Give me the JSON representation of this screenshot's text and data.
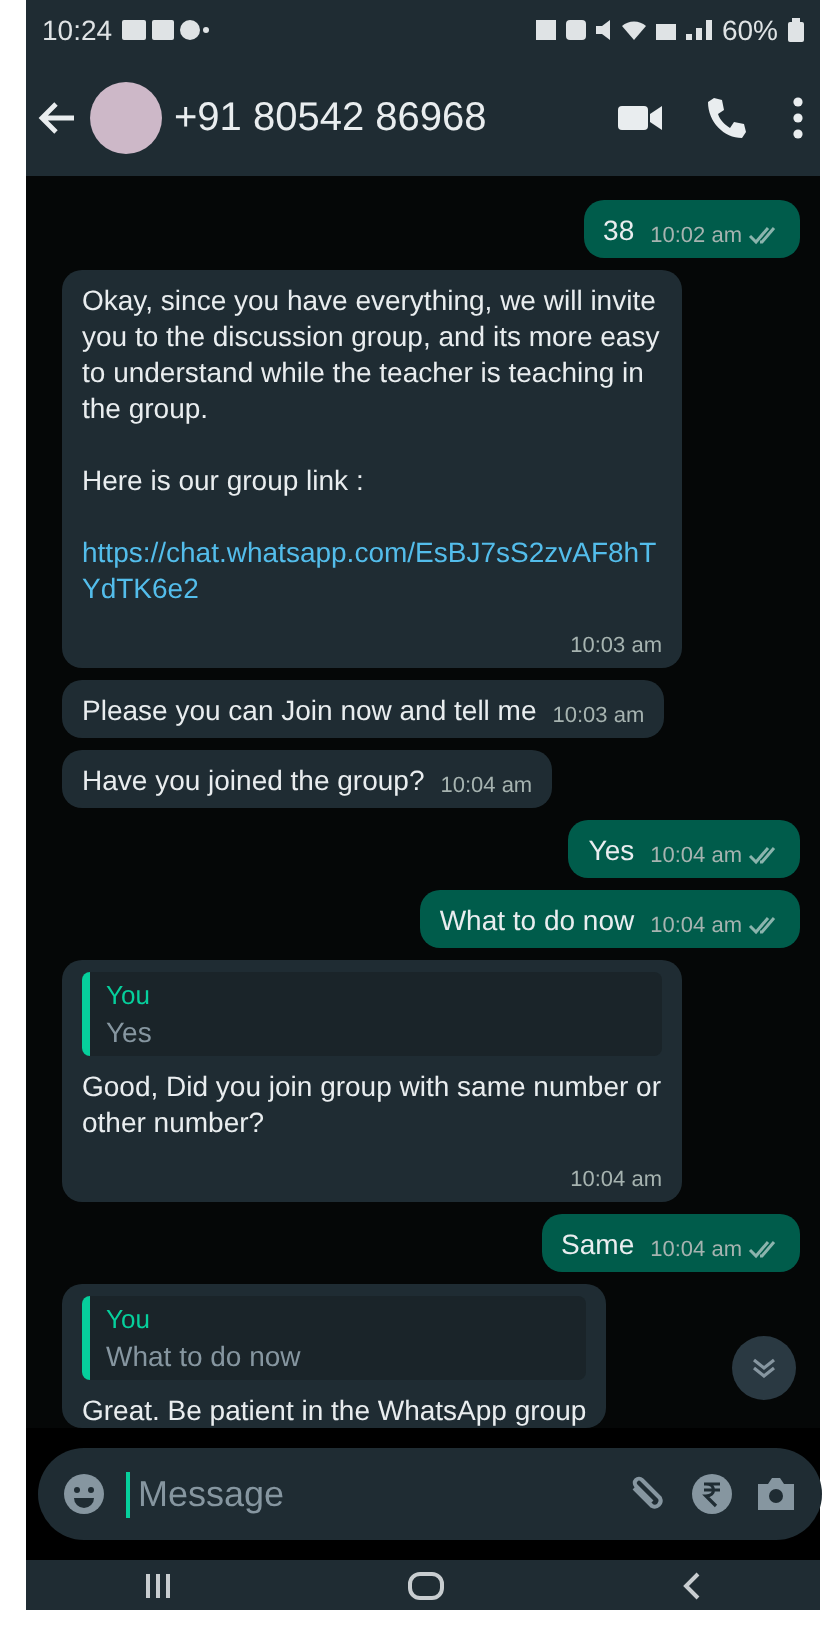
{
  "status_bar": {
    "time": "10:24",
    "battery": "60%"
  },
  "header": {
    "contact": "+91 80542 86968"
  },
  "messages": [
    {
      "kind": "out",
      "parts": [
        {
          "kind": "text",
          "text": "38"
        }
      ],
      "time": "10:02 am",
      "double_tick": true
    },
    {
      "kind": "in",
      "parts": [
        {
          "kind": "text",
          "text": "Okay, since you have everything, we will invite you to the discussion group, and its more easy to understand  while the teacher is teaching in the group."
        },
        {
          "kind": "text",
          "text": "Here is our group link :"
        },
        {
          "kind": "link",
          "text": "https://chat.whatsapp.com/EsBJ7sS2zvAF8hTYdTK6e2"
        }
      ],
      "time": "10:03 am"
    },
    {
      "kind": "in",
      "parts": [
        {
          "kind": "text",
          "text": "Please you can Join now and tell me"
        }
      ],
      "time": "10:03 am"
    },
    {
      "kind": "in",
      "parts": [
        {
          "kind": "text",
          "text": "Have you joined the group?"
        }
      ],
      "time": "10:04 am"
    },
    {
      "kind": "out",
      "parts": [
        {
          "kind": "text",
          "text": "Yes"
        }
      ],
      "time": "10:04 am",
      "double_tick": true
    },
    {
      "kind": "out",
      "parts": [
        {
          "kind": "text",
          "text": "What to do now"
        }
      ],
      "time": "10:04 am",
      "double_tick": true
    },
    {
      "kind": "in",
      "quote": {
        "author": "You",
        "text": "Yes"
      },
      "parts": [
        {
          "kind": "text",
          "text": "Good, Did you join group with same number or other number?"
        }
      ],
      "time": "10:04 am"
    },
    {
      "kind": "out",
      "parts": [
        {
          "kind": "text",
          "text": "Same"
        }
      ],
      "time": "10:04 am",
      "double_tick": true
    },
    {
      "kind": "in",
      "quote": {
        "author": "You",
        "text": "What to do now"
      },
      "parts": [
        {
          "kind": "text",
          "text": "Great. Be patient in the WhatsApp group"
        }
      ]
    }
  ],
  "composer": {
    "placeholder": "Message"
  }
}
